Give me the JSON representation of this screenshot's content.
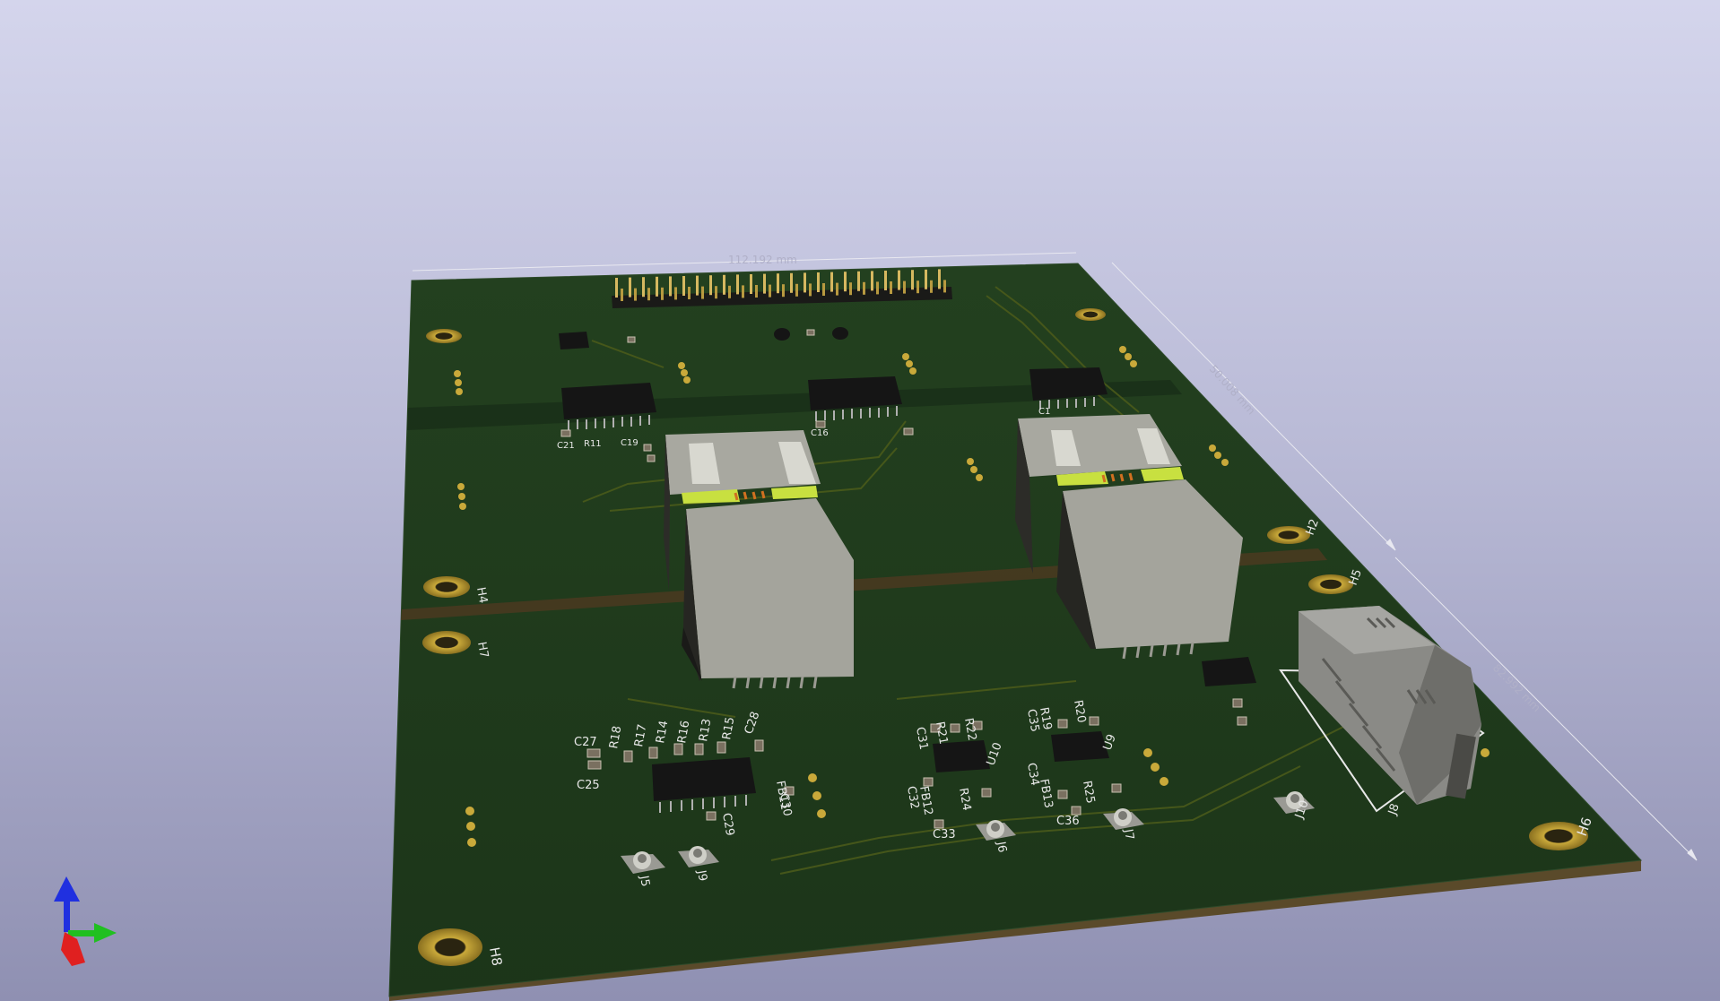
{
  "viewer": {
    "board_dimension_right": "82.992 mm",
    "board_dimension_right_upper": "50.008 mm",
    "board_dimension_top": "112.192 mm"
  },
  "colors": {
    "board_mask": "#1f3a1c",
    "board_edge": "#5a4a2a",
    "pad_gold": "#c9a93a",
    "silkscreen": "#e8e8e8",
    "rj45_body": "#a8a8a0",
    "axis_x": "#e02020",
    "axis_y": "#20c020",
    "axis_z": "#2030e0"
  },
  "components": {
    "labels": [
      {
        "text": "H8"
      },
      {
        "text": "H6"
      },
      {
        "text": "H4"
      },
      {
        "text": "H7"
      },
      {
        "text": "H5"
      },
      {
        "text": "H2"
      },
      {
        "text": "J5"
      },
      {
        "text": "J9"
      },
      {
        "text": "J6"
      },
      {
        "text": "J7"
      },
      {
        "text": "J10"
      },
      {
        "text": "J8"
      },
      {
        "text": "U9"
      },
      {
        "text": "U10"
      },
      {
        "text": "C27"
      },
      {
        "text": "C25"
      },
      {
        "text": "C28"
      },
      {
        "text": "C29"
      },
      {
        "text": "C30"
      },
      {
        "text": "FB11"
      },
      {
        "text": "R18"
      },
      {
        "text": "R17"
      },
      {
        "text": "R14"
      },
      {
        "text": "R16"
      },
      {
        "text": "R13"
      },
      {
        "text": "R15"
      },
      {
        "text": "C31"
      },
      {
        "text": "R21"
      },
      {
        "text": "R22"
      },
      {
        "text": "C32"
      },
      {
        "text": "FB12"
      },
      {
        "text": "R24"
      },
      {
        "text": "C33"
      },
      {
        "text": "R19"
      },
      {
        "text": "C35"
      },
      {
        "text": "R20"
      },
      {
        "text": "C34"
      },
      {
        "text": "FB13"
      },
      {
        "text": "R25"
      },
      {
        "text": "C36"
      },
      {
        "text": "C21"
      },
      {
        "text": "R11"
      },
      {
        "text": "C19"
      },
      {
        "text": "C16"
      },
      {
        "text": "C1"
      }
    ]
  }
}
